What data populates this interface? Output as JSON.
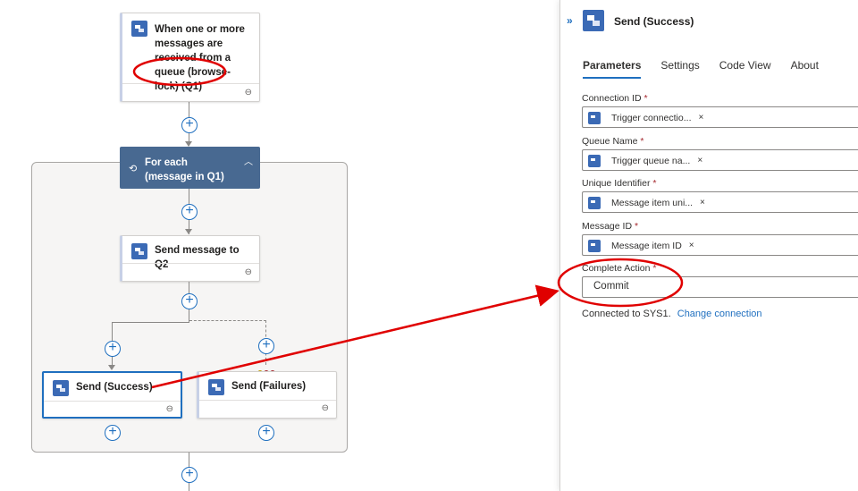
{
  "canvas": {
    "trigger": {
      "title": "When one or more messages are received from a queue (browse-lock) (Q1)"
    },
    "foreach": {
      "title": "For each (message in Q1)"
    },
    "send_q2": {
      "title": "Send message to Q2"
    },
    "send_success": {
      "title": "Send (Success)"
    },
    "send_failures": {
      "title": "Send (Failures)"
    },
    "run_after_colors": [
      "#c19c00",
      "#a4262c",
      "#a4262c"
    ],
    "accent": "#1f6fbf",
    "foreach_color": "#486991",
    "annotation_color": "#e00000"
  },
  "panel": {
    "title": "Send (Success)",
    "collapse_icon": "double-chevron-right-icon",
    "tabs": [
      {
        "label": "Parameters",
        "active": true
      },
      {
        "label": "Settings",
        "active": false
      },
      {
        "label": "Code View",
        "active": false
      },
      {
        "label": "About",
        "active": false
      }
    ],
    "fields": [
      {
        "label": "Connection ID",
        "required": "*",
        "token": "Trigger connectio...",
        "remove": "×"
      },
      {
        "label": "Queue Name",
        "required": "*",
        "token": "Trigger queue na...",
        "remove": "×"
      },
      {
        "label": "Unique Identifier",
        "required": "*",
        "token": "Message item uni...",
        "remove": "×"
      },
      {
        "label": "Message ID",
        "required": "*",
        "token": "Message item ID",
        "remove": "×"
      }
    ],
    "complete_action": {
      "label": "Complete Action",
      "required": "*",
      "value": "Commit"
    },
    "connected_text": "Connected to SYS1.",
    "change_connection": "Change connection"
  }
}
